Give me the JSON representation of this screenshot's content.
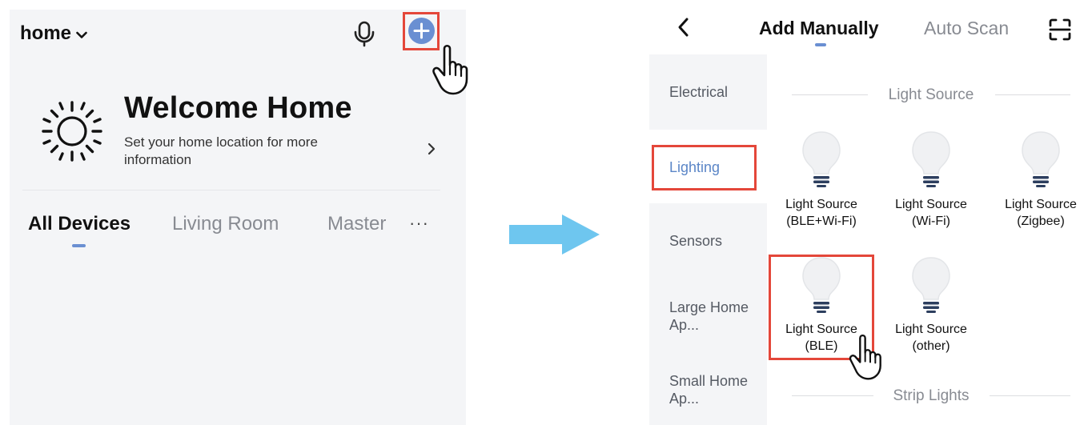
{
  "left": {
    "home_label": "home",
    "welcome_title": "Welcome Home",
    "welcome_subtitle": "Set your home location for more information",
    "tabs": [
      {
        "label": "All Devices"
      },
      {
        "label": "Living Room"
      },
      {
        "label": "Master"
      }
    ],
    "more_label": "···",
    "icons": {
      "dropdown": "chevron-down-icon",
      "mic": "microphone-icon",
      "add": "plus-circle-icon",
      "weather": "sun-icon",
      "chevron": "chevron-right-icon",
      "pointer": "hand-pointer-icon"
    }
  },
  "right": {
    "header": {
      "title_active": "Add Manually",
      "title_inactive": "Auto Scan",
      "icons": {
        "back": "chevron-left-icon",
        "scan": "scan-icon"
      }
    },
    "sidebar": [
      {
        "label": "Electrical"
      },
      {
        "label": "Lighting"
      },
      {
        "label": "Sensors"
      },
      {
        "label": "Large Home Ap..."
      },
      {
        "label": "Small Home Ap..."
      }
    ],
    "sections": [
      {
        "title": "Light Source",
        "devices": [
          {
            "name_line1": "Light Source",
            "name_line2": "(BLE+Wi-Fi)"
          },
          {
            "name_line1": "Light Source",
            "name_line2": "(Wi-Fi)"
          },
          {
            "name_line1": "Light Source",
            "name_line2": "(Zigbee)"
          },
          {
            "name_line1": "Light Source",
            "name_line2": "(BLE)"
          },
          {
            "name_line1": "Light Source",
            "name_line2": "(other)"
          }
        ]
      },
      {
        "title": "Strip Lights"
      }
    ]
  },
  "colors": {
    "accent": "#6a8fd2",
    "highlight": "#e4473a",
    "arrow": "#6ec6ef",
    "panel_bg": "#f4f5f7"
  }
}
